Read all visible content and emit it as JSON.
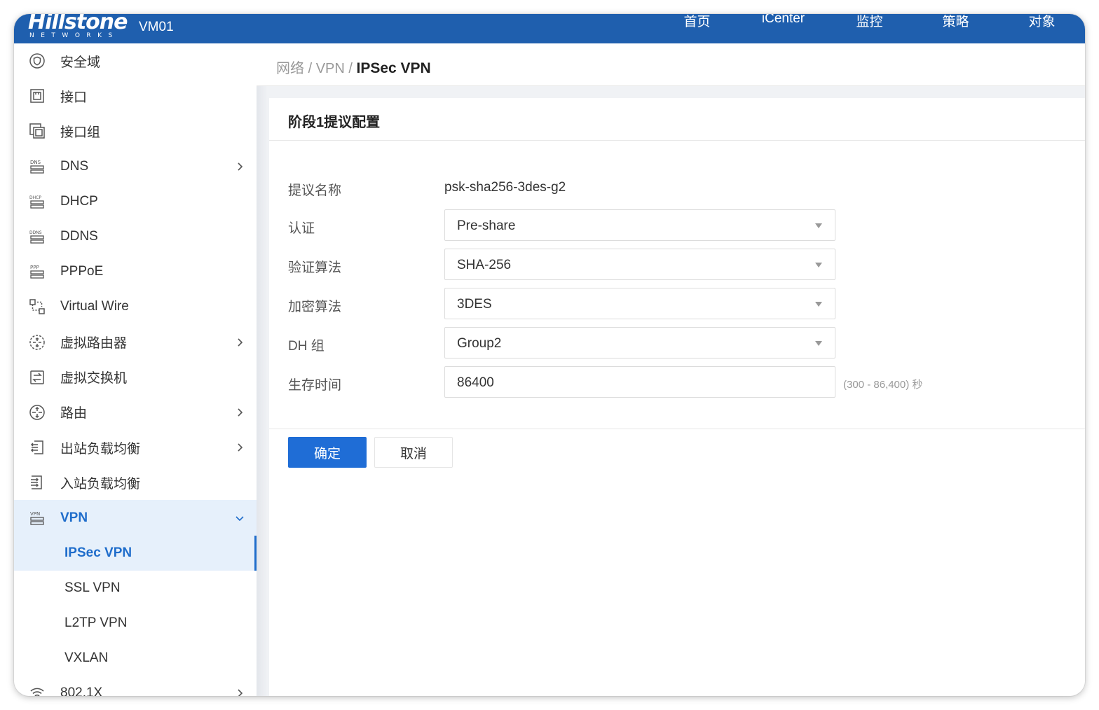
{
  "header": {
    "logo_text": "Hillstone",
    "logo_subtext": "NETWORKS",
    "device_name": "VM01",
    "nav": [
      "首页",
      "iCenter",
      "监控",
      "策略",
      "对象"
    ]
  },
  "sidebar": {
    "items": [
      {
        "label": "安全域",
        "icon": "shield-icon"
      },
      {
        "label": "接口",
        "icon": "interface-icon"
      },
      {
        "label": "接口组",
        "icon": "interface-group-icon"
      },
      {
        "label": "DNS",
        "icon": "dns-icon"
      },
      {
        "label": "DHCP",
        "icon": "dhcp-icon"
      },
      {
        "label": "DDNS",
        "icon": "ddns-icon"
      },
      {
        "label": "PPPoE",
        "icon": "pppoe-icon"
      },
      {
        "label": "Virtual Wire",
        "icon": "virtual-wire-icon"
      },
      {
        "label": "虚拟路由器",
        "icon": "virtual-router-icon"
      },
      {
        "label": "虚拟交换机",
        "icon": "virtual-switch-icon"
      },
      {
        "label": "路由",
        "icon": "routing-icon"
      },
      {
        "label": "出站负载均衡",
        "icon": "outbound-lb-icon"
      },
      {
        "label": "入站负载均衡",
        "icon": "inbound-lb-icon"
      },
      {
        "label": "VPN",
        "icon": "vpn-icon"
      },
      {
        "label": "802.1X",
        "icon": "wifi-icon"
      }
    ],
    "vpn_sub": [
      "IPSec VPN",
      "SSL VPN",
      "L2TP VPN",
      "VXLAN"
    ]
  },
  "breadcrumb": {
    "level1": "网络",
    "level2": "VPN",
    "current": "IPSec VPN",
    "sep": "/"
  },
  "panel": {
    "title": "阶段1提议配置",
    "fields": {
      "name_label": "提议名称",
      "name_value": "psk-sha256-3des-g2",
      "auth_label": "认证",
      "auth_value": "Pre-share",
      "hash_label": "验证算法",
      "hash_value": "SHA-256",
      "encrypt_label": "加密算法",
      "encrypt_value": "3DES",
      "dh_label": "DH 组",
      "dh_value": "Group2",
      "lifetime_label": "生存时间",
      "lifetime_value": "86400",
      "lifetime_hint": "(300 - 86,400) 秒"
    },
    "ok_label": "确定",
    "cancel_label": "取消"
  },
  "colors": {
    "header_bg": "#1f5fae",
    "accent": "#1f6dcb",
    "primary_button": "#1f6dd6"
  }
}
